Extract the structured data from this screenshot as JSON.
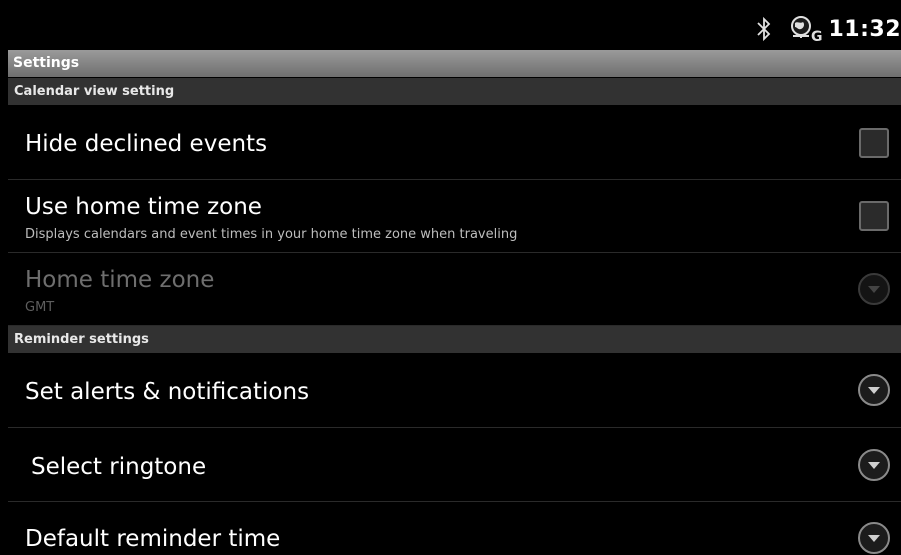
{
  "status_bar": {
    "time": "11:32",
    "icons": [
      "bluetooth-icon",
      "gps-g-network-icon"
    ],
    "network_letter": "G"
  },
  "title": "Settings",
  "sections": [
    {
      "header": "Calendar view setting",
      "items": [
        {
          "title": "Hide declined events",
          "summary": "",
          "widget": "checkbox",
          "checked": false,
          "enabled": true
        },
        {
          "title": "Use home time zone",
          "summary": "Displays calendars and event times in your home time zone when traveling",
          "widget": "checkbox",
          "checked": false,
          "enabled": true
        },
        {
          "title": "Home time zone",
          "summary": "GMT",
          "widget": "dropdown",
          "enabled": false
        }
      ]
    },
    {
      "header": "Reminder settings",
      "items": [
        {
          "title": "Set alerts & notifications",
          "summary": "",
          "widget": "dropdown",
          "enabled": true
        },
        {
          "title": "Select ringtone",
          "summary": "",
          "widget": "dropdown",
          "enabled": true
        },
        {
          "title": "Default reminder time",
          "summary": "",
          "widget": "dropdown",
          "enabled": true
        }
      ]
    }
  ],
  "colors": {
    "background": "#000000",
    "title_bar": "#8a8a8a",
    "section_header": "#323232",
    "disabled_text": "#6e6e6e"
  }
}
